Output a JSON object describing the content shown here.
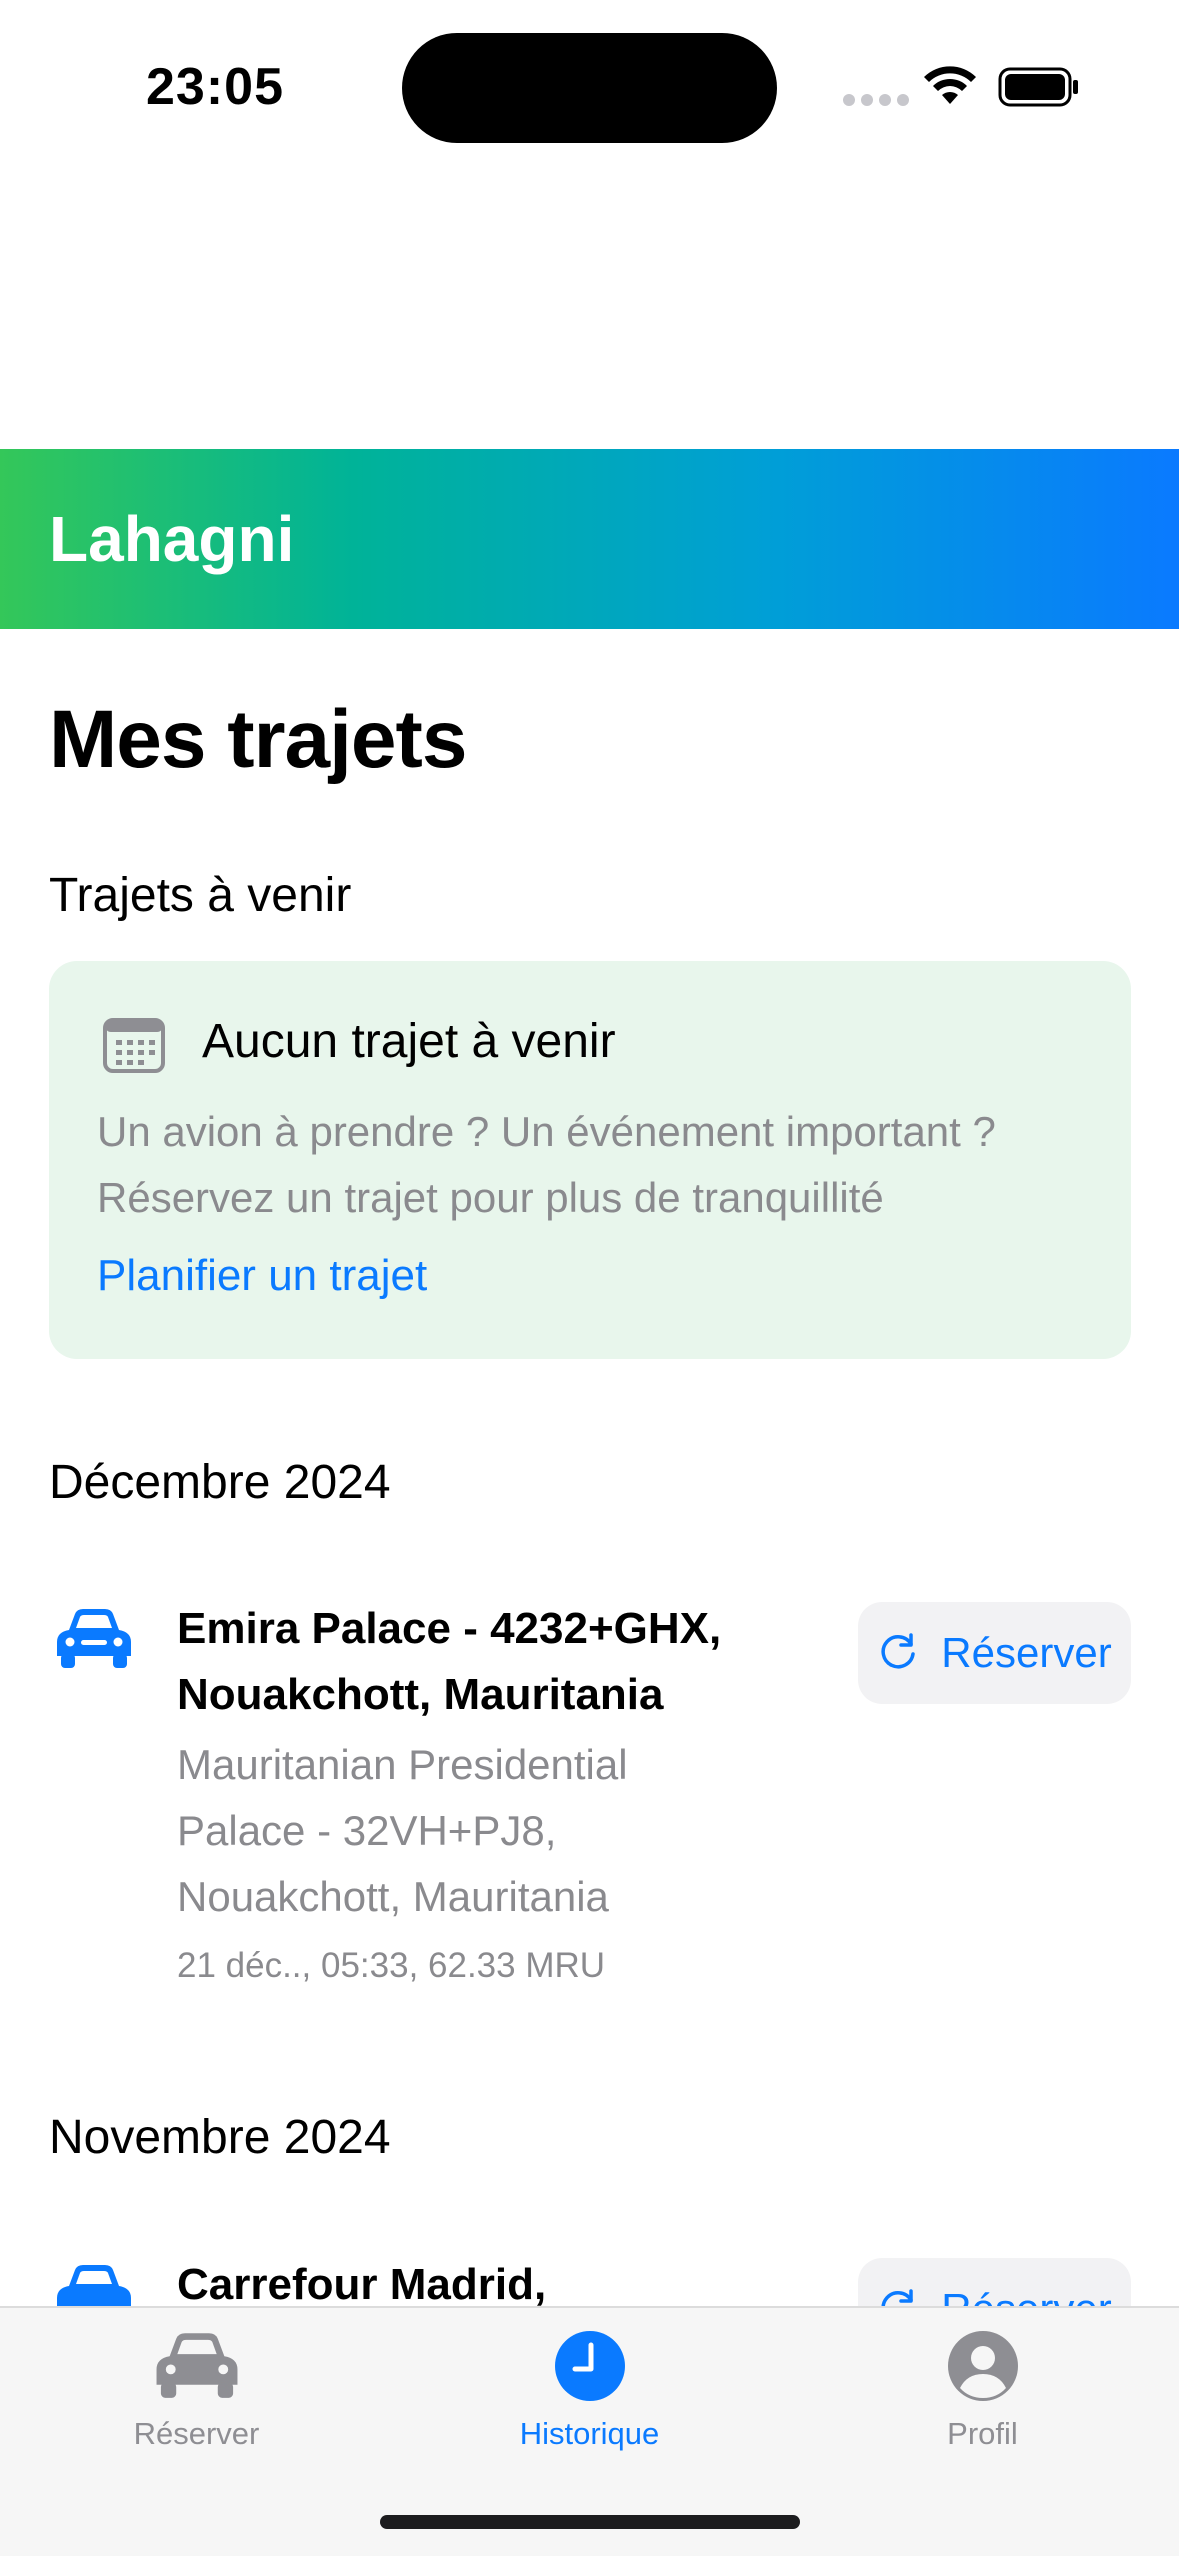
{
  "status_bar": {
    "time": "23:05"
  },
  "brand": {
    "name": "Lahagni"
  },
  "page": {
    "title": "Mes trajets"
  },
  "upcoming": {
    "heading": "Trajets à venir",
    "empty_title": "Aucun trajet à venir",
    "empty_description": "Un avion à prendre ? Un événement important ? Réservez un trajet pour plus de tranquillité",
    "plan_link": "Planifier un trajet"
  },
  "history": [
    {
      "month": "Décembre 2024",
      "trips": [
        {
          "origin": "Emira Palace - 4232+GHX, Nouakchott, Mauritania",
          "destination": "Mauritanian Presidential Palace - 32VH+PJ8, Nouakchott, Mauritania",
          "meta": "21 déc.., 05:33, 62.33 MRU",
          "rebook_label": "Réserver"
        }
      ]
    },
    {
      "month": "Novembre 2024",
      "trips": [
        {
          "origin": "Carrefour Madrid,",
          "rebook_label": "Réserver"
        }
      ]
    }
  ],
  "tab_bar": {
    "items": [
      {
        "label": "Réserver",
        "icon": "car-icon",
        "active": false
      },
      {
        "label": "Historique",
        "icon": "clock-icon",
        "active": true
      },
      {
        "label": "Profil",
        "icon": "person-icon",
        "active": false
      }
    ]
  },
  "colors": {
    "accent": "#0a7aff",
    "gradient_start": "#34c759",
    "gradient_end": "#0a7aff",
    "card_background": "#e8f6ec",
    "secondary_text": "#8a8a8e"
  }
}
